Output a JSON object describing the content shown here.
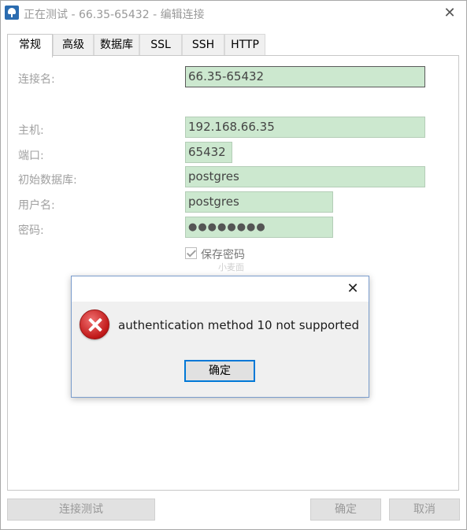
{
  "window": {
    "title": "正在测试 - 66.35-65432 - 编辑连接",
    "close_glyph": "✕"
  },
  "tabs": [
    {
      "label": "常规",
      "active": true
    },
    {
      "label": "高级"
    },
    {
      "label": "数据库"
    },
    {
      "label": "SSL"
    },
    {
      "label": "SSH"
    },
    {
      "label": "HTTP"
    }
  ],
  "form": {
    "connection_name_label": "连接名:",
    "connection_name_value": "66.35-65432",
    "host_label": "主机:",
    "host_value": "192.168.66.35",
    "port_label": "端口:",
    "port_value": "65432",
    "initial_db_label": "初始数据库:",
    "initial_db_value": "postgres",
    "username_label": "用户名:",
    "username_value": "postgres",
    "password_label": "密码:",
    "password_value": "●●●●●●●●",
    "save_password_label": "保存密码",
    "save_password_checked": true
  },
  "watermark": "小麦面",
  "buttons": {
    "test_connection": "连接测试",
    "ok": "确定",
    "cancel": "取消"
  },
  "dialog": {
    "close_glyph": "✕",
    "message": "authentication method 10 not supported",
    "ok_label": "确定",
    "icon": "error-icon"
  },
  "colors": {
    "field_bg": "#cce8cf",
    "dialog_border": "#7a9ccc",
    "focus_border": "#0078d7",
    "error_red": "#c01818"
  }
}
